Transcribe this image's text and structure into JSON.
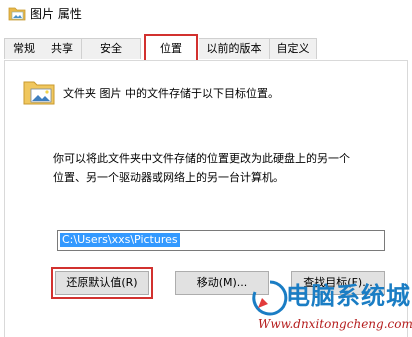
{
  "window": {
    "title": "图片 属性",
    "icon": "folder-pictures-icon"
  },
  "tabs": [
    {
      "label": "常规",
      "active": false
    },
    {
      "label": "共享",
      "active": false
    },
    {
      "label": "安全",
      "active": false
    },
    {
      "label": "位置",
      "active": true
    },
    {
      "label": "以前的版本",
      "active": false
    },
    {
      "label": "自定义",
      "active": false
    }
  ],
  "location": {
    "folder_icon": "folder-pictures-icon",
    "description": "文件夹 图片 中的文件存储于以下目标位置。",
    "info_line1": "你可以将此文件夹中文件存储的位置更改为此硬盘上的另一个",
    "info_line2": "位置、另一个驱动器或网络上的另一台计算机。",
    "path_value": "C:\\Users\\xxs\\Pictures"
  },
  "buttons": {
    "restore_default": "还原默认值(R)",
    "move": "移动(M)...",
    "find_target": "查找目标(F)..."
  },
  "colors": {
    "highlight_box": "#d2312f",
    "selection": "#3399ff"
  },
  "watermark": {
    "title": "电脑系统城",
    "url": "Www.dnxitongcheng.com"
  }
}
